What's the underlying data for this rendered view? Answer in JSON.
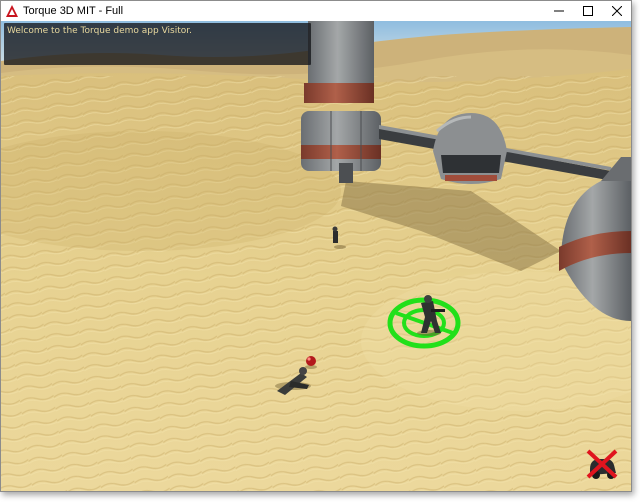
{
  "window": {
    "title": "Torque 3D MIT - Full",
    "controls": {
      "minimize": "minimize-icon",
      "maximize": "maximize-icon",
      "close": "close-icon"
    }
  },
  "hud": {
    "chat_message": "Welcome to the Torque demo app Visitor."
  },
  "icons": {
    "app": "torque-logo-icon",
    "status": "no-vehicle-icon"
  },
  "colors": {
    "sand": "#e6cf8a",
    "sky": "#9ec8e8",
    "selection_ring": "#22e01a",
    "status_cross": "#e0141e"
  }
}
